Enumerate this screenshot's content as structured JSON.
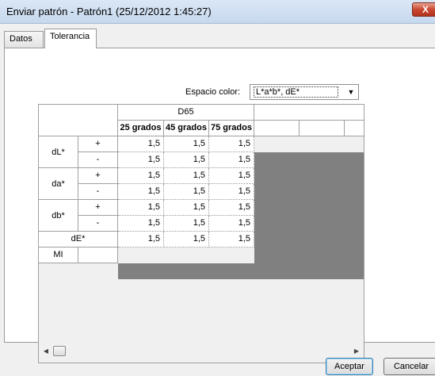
{
  "window": {
    "title": "Enviar patrón - Patrón1 (25/12/2012 1:45:27)",
    "close_label": "X"
  },
  "tabs": [
    {
      "label": "Datos",
      "active": false
    },
    {
      "label": "Tolerancia",
      "active": true
    }
  ],
  "color_space": {
    "label": "Espacio color:",
    "value": "L*a*b*, dE*"
  },
  "grid": {
    "illuminant": "D65",
    "columns": [
      "25 grados",
      "45 grados",
      "75 grados"
    ],
    "rows": [
      {
        "group": "dL*",
        "sign": "+",
        "values": [
          "1,5",
          "1,5",
          "1,5"
        ]
      },
      {
        "group": "dL*",
        "sign": "-",
        "values": [
          "1,5",
          "1,5",
          "1,5"
        ]
      },
      {
        "group": "da*",
        "sign": "+",
        "values": [
          "1,5",
          "1,5",
          "1,5"
        ]
      },
      {
        "group": "da*",
        "sign": "-",
        "values": [
          "1,5",
          "1,5",
          "1,5"
        ]
      },
      {
        "group": "db*",
        "sign": "+",
        "values": [
          "1,5",
          "1,5",
          "1,5"
        ]
      },
      {
        "group": "db*",
        "sign": "-",
        "values": [
          "1,5",
          "1,5",
          "1,5"
        ]
      }
    ],
    "de_row": {
      "label": "dE*",
      "values": [
        "1,5",
        "1,5",
        "1,5"
      ]
    },
    "mi_label": "MI"
  },
  "buttons": {
    "accept": "Aceptar",
    "cancel": "Cancelar"
  }
}
